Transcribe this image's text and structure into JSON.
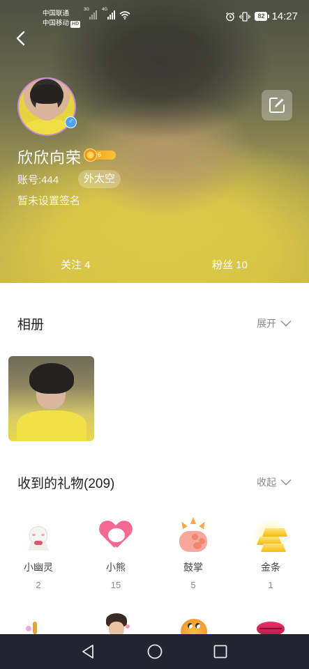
{
  "status_bar": {
    "carrier1": "中国联通",
    "carrier2": "中国移动",
    "hd": "HD",
    "net1": "3G",
    "net2": "4G",
    "battery": "82",
    "time": "14:27"
  },
  "profile": {
    "nickname": "欣欣向荣",
    "level": "6",
    "account": "账号:444",
    "region": "外太空",
    "signature": "暂未设置签名",
    "following": "关注 4",
    "fans": "粉丝 10",
    "gender": "♂"
  },
  "album": {
    "title": "相册",
    "toggle": "展开"
  },
  "gifts": {
    "title": "收到的礼物(209)",
    "toggle": "收起",
    "items": [
      {
        "name": "小幽灵",
        "count": "2"
      },
      {
        "name": "小熊",
        "count": "15"
      },
      {
        "name": "鼓掌",
        "count": "5"
      },
      {
        "name": "金条",
        "count": "1"
      }
    ]
  },
  "colors": {
    "accent_ring": "#c98ad9",
    "gender_badge": "#4ea3ee",
    "level_badge": "#f7a21b",
    "nav_bar": "#222530"
  }
}
